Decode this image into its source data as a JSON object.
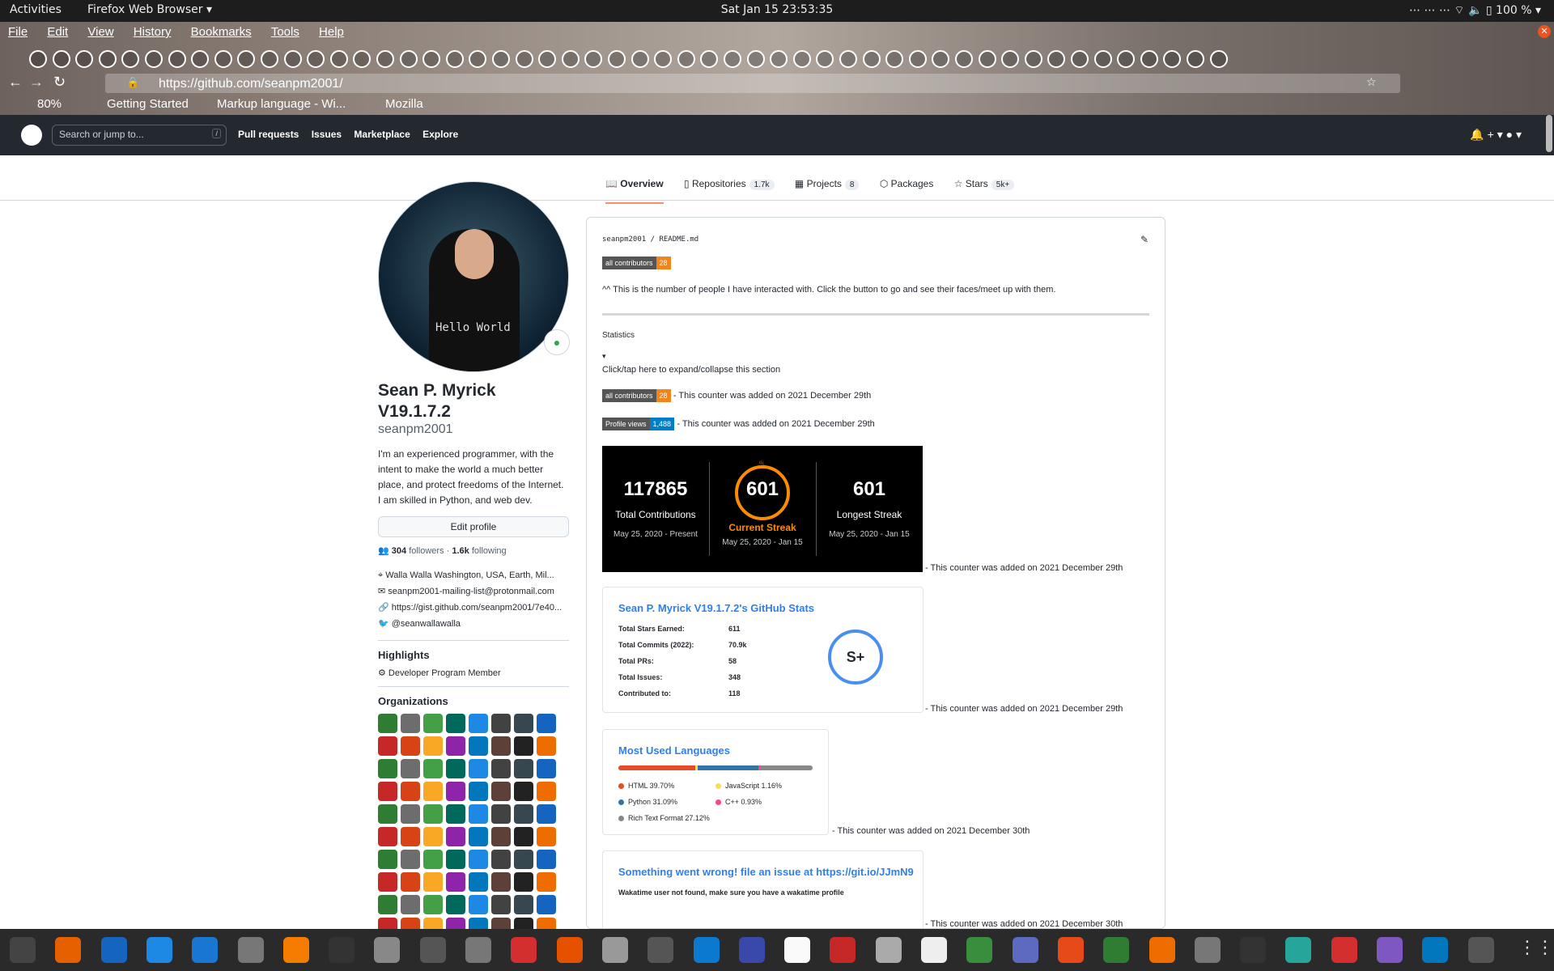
{
  "system": {
    "activities": "Activities",
    "app_menu": "Firefox Web Browser ▾",
    "clock": "Sat Jan 15  23:53:35",
    "tray": "⋯   ⋯   ⋯   ⌔  🔈  ▯ 100 % ▾"
  },
  "browser": {
    "menu": [
      "File",
      "Edit",
      "View",
      "History",
      "Bookmarks",
      "Tools",
      "Help"
    ],
    "url": "https://github.com/seanpm2001/",
    "zoom": "80%",
    "bookmarks": [
      "Getting Started",
      "Markup language - Wi...",
      "Mozilla"
    ]
  },
  "github": {
    "search_placeholder": "Search or jump to...",
    "search_key": "/",
    "nav": [
      "Pull requests",
      "Issues",
      "Marketplace",
      "Explore"
    ],
    "right": "🔔  + ▾  ● ▾"
  },
  "tabs": [
    {
      "label": "Overview",
      "count": ""
    },
    {
      "label": "Repositories",
      "count": "1.7k"
    },
    {
      "label": "Projects",
      "count": "8"
    },
    {
      "label": "Packages",
      "count": ""
    },
    {
      "label": "Stars",
      "count": "5k+"
    }
  ],
  "profile": {
    "name": "Sean P. Myrick V19.1.7.2",
    "login": "seanpm2001",
    "avatar_text": "Hello World",
    "bio": "I'm an experienced programmer, with the intent to make the world a much better place, and protect freedoms of the Internet. I am skilled in Python, and web dev.",
    "edit_button": "Edit profile",
    "followers": "304",
    "followers_label": "followers",
    "following": "1.6k",
    "following_label": "following",
    "location": "Walla Walla Washington, USA, Earth, Mil...",
    "email": "seanpm2001-mailing-list@protonmail.com",
    "website": "https://gist.github.com/seanpm2001/7e40...",
    "twitter": "@seanwallawalla",
    "highlights_title": "Highlights",
    "highlight": "Developer Program Member",
    "orgs_title": "Organizations"
  },
  "readme": {
    "path": "seanpm2001 / README.md",
    "badge_label": "all contributors",
    "badge_value": "28",
    "intro": "^^ This is the number of people I have interacted with. Click the button to go and see their faces/meet up with them.",
    "statistics": "Statistics",
    "toggle": "▾",
    "toggle_text": "Click/tap here to expand/collapse this section",
    "note_dec29": "- This counter was added on 2021 December 29th",
    "note_dec30": "- This counter was added on 2021 December 30th",
    "views_label": "Profile views",
    "views_value": "1,488"
  },
  "streak": {
    "total": "117865",
    "total_label": "Total Contributions",
    "total_range": "May 25, 2020 - Present",
    "current": "601",
    "current_label": "Current Streak",
    "current_range": "May 25, 2020 - Jan 15",
    "longest": "601",
    "longest_label": "Longest Streak",
    "longest_range": "May 25, 2020 - Jan 15",
    "accent": "#fb8c00"
  },
  "stats": {
    "title": "Sean P. Myrick V19.1.7.2's GitHub Stats",
    "rows": [
      {
        "label": "Total Stars Earned:",
        "value": "611"
      },
      {
        "label": "Total Commits (2022):",
        "value": "70.9k"
      },
      {
        "label": "Total PRs:",
        "value": "58"
      },
      {
        "label": "Total Issues:",
        "value": "348"
      },
      {
        "label": "Contributed to:",
        "value": "118"
      }
    ],
    "grade": "S+"
  },
  "languages": {
    "title": "Most Used Languages",
    "items": [
      {
        "name": "HTML 39.70%",
        "pct": 39.7,
        "color": "#e34c26"
      },
      {
        "name": "JavaScript 1.16%",
        "pct": 1.16,
        "color": "#f1e05a"
      },
      {
        "name": "Python 31.09%",
        "pct": 31.09,
        "color": "#3572A5"
      },
      {
        "name": "C++ 0.93%",
        "pct": 0.93,
        "color": "#f34b7d"
      },
      {
        "name": "Rich Text Format 27.12%",
        "pct": 27.12,
        "color": "#888888"
      }
    ]
  },
  "wakatime": {
    "title": "Something went wrong! file an issue at https://git.io/JJmN9",
    "message": "Wakatime user not found, make sure you have a wakatime profile"
  }
}
